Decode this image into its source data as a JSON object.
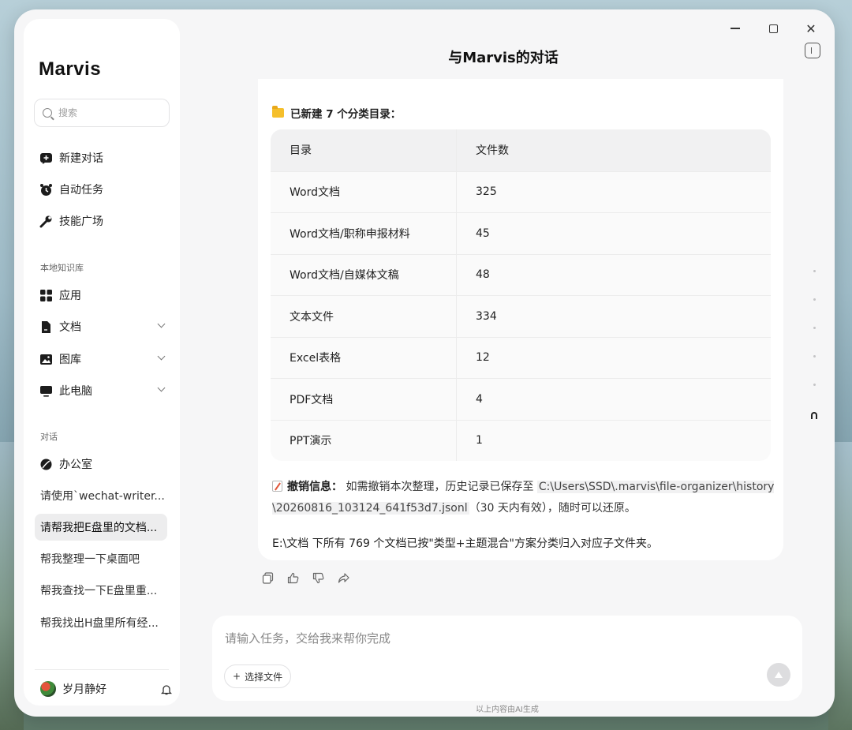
{
  "app": {
    "brand": "Marvis",
    "title": "与Marvis的对话"
  },
  "window_controls": {
    "minimize_icon": "minimize-icon",
    "maximize_icon": "maximize-icon",
    "close_icon": "close-icon",
    "close_glyph": "✕"
  },
  "sidebar": {
    "search_placeholder": "搜索",
    "primary": [
      {
        "label": "新建对话",
        "icon": "new-chat-icon"
      },
      {
        "label": "自动任务",
        "icon": "alarm-clock-icon"
      },
      {
        "label": "技能广场",
        "icon": "wrench-icon"
      }
    ],
    "kb_label": "本地知识库",
    "kb_items": [
      {
        "label": "应用",
        "icon": "apps-grid-icon"
      },
      {
        "label": "文档",
        "icon": "document-icon"
      },
      {
        "label": "图库",
        "icon": "image-icon"
      },
      {
        "label": "此电脑",
        "icon": "monitor-icon"
      }
    ],
    "conv_label": "对话",
    "conversations": [
      {
        "label": "办公室"
      },
      {
        "label": "请使用`wechat-writer..."
      },
      {
        "label": "请帮我把E盘里的文档..."
      },
      {
        "label": "帮我整理一下桌面吧"
      },
      {
        "label": "帮我查找一下E盘里重..."
      },
      {
        "label": "帮我找出H盘里所有经..."
      }
    ],
    "user": {
      "name": "岁月静好"
    }
  },
  "message": {
    "created_heading": "已新建 7 个分类目录：",
    "table": {
      "headers": [
        "目录",
        "文件数"
      ],
      "rows": [
        [
          "Word文档",
          "325"
        ],
        [
          "Word文档/职称申报材料",
          "45"
        ],
        [
          "Word文档/自媒体文稿",
          "48"
        ],
        [
          "文本文件",
          "334"
        ],
        [
          "Excel表格",
          "12"
        ],
        [
          "PDF文档",
          "4"
        ],
        [
          "PPT演示",
          "1"
        ]
      ]
    },
    "undo_label": "撤销信息：",
    "undo_text_1": "如需撤销本次整理，历史记录已保存至",
    "undo_path": "C:\\Users\\SSD\\.marvis\\file-organizer\\history\\20260816_103124_641f53d7.jsonl",
    "undo_text_2": "（30 天内有效），随时可以还原。",
    "summary": "E:\\文档 下所有 769 个文档已按\"类型+主题混合\"方案分类归入对应子文件夹。"
  },
  "composer": {
    "placeholder": "请输入任务，交给我来帮你完成",
    "file_button": "选择文件",
    "footer_note": "以上内容由AI生成"
  }
}
